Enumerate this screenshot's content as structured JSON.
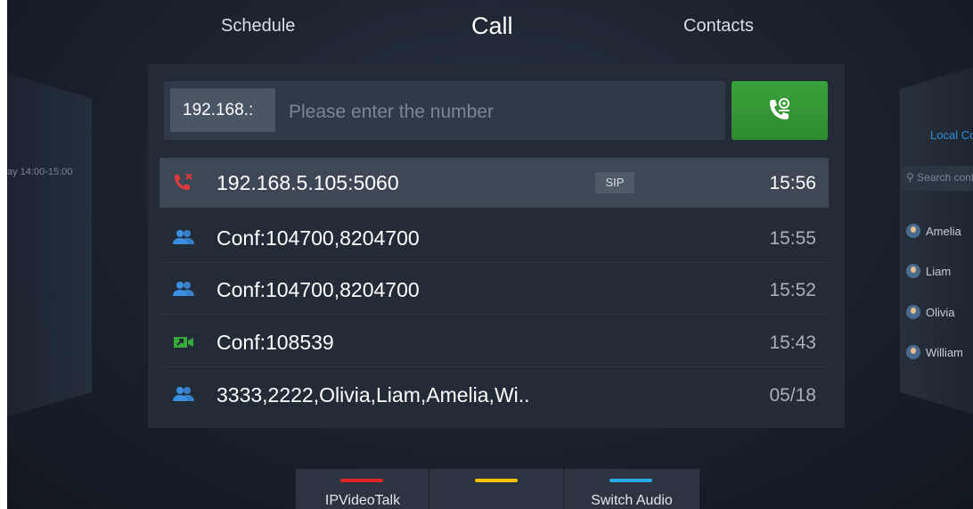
{
  "tabs": {
    "schedule": "Schedule",
    "call": "Call",
    "contacts": "Contacts"
  },
  "left_panel": {
    "meeting_time": "ay 14:00-15:00"
  },
  "right_panel": {
    "title": "Local Co",
    "search_placeholder": "Search cont",
    "contacts": [
      "Amelia",
      "Liam",
      "Olivia",
      "William"
    ]
  },
  "dial": {
    "value": "192.168.:",
    "placeholder": "Please enter the number",
    "call_icon": "video-call-icon",
    "call_button_color": "#2e8b2f"
  },
  "history": [
    {
      "icon": "missed-call-icon",
      "title": "192.168.5.105:5060",
      "badge": "SIP",
      "time": "15:56",
      "selected": true
    },
    {
      "icon": "conference-icon",
      "title": "Conf:104700,8204700",
      "time": "15:55"
    },
    {
      "icon": "conference-icon",
      "title": "Conf:104700,8204700",
      "time": "15:52"
    },
    {
      "icon": "video-conference-icon",
      "title": "Conf:108539",
      "time": "15:43"
    },
    {
      "icon": "conference-icon",
      "title": "3333,2222,Olivia,Liam,Amelia,Wi..",
      "time": "05/18"
    }
  ],
  "softkeys": [
    {
      "label": "IPVideoTalk",
      "color": "#e02424"
    },
    {
      "label": "",
      "color": "#f2c300"
    },
    {
      "label": "Switch Audio",
      "color": "#2aa8e6"
    }
  ]
}
